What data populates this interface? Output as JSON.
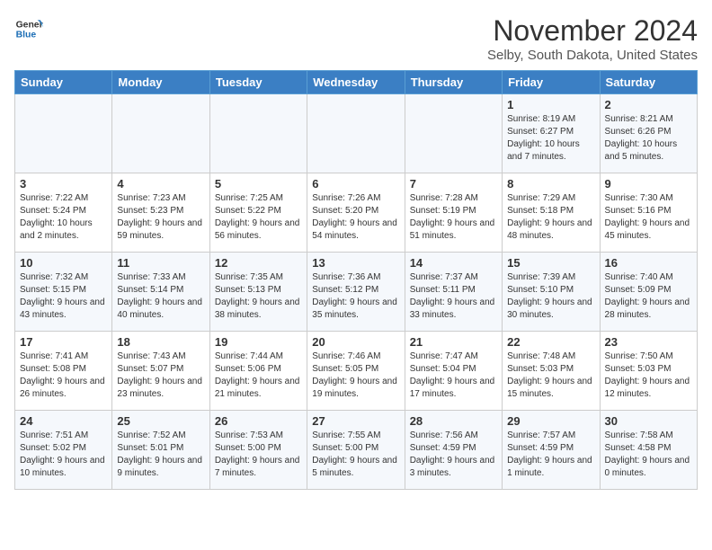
{
  "header": {
    "logo_line1": "General",
    "logo_line2": "Blue",
    "month": "November 2024",
    "location": "Selby, South Dakota, United States"
  },
  "days_of_week": [
    "Sunday",
    "Monday",
    "Tuesday",
    "Wednesday",
    "Thursday",
    "Friday",
    "Saturday"
  ],
  "weeks": [
    [
      {
        "num": "",
        "info": ""
      },
      {
        "num": "",
        "info": ""
      },
      {
        "num": "",
        "info": ""
      },
      {
        "num": "",
        "info": ""
      },
      {
        "num": "",
        "info": ""
      },
      {
        "num": "1",
        "info": "Sunrise: 8:19 AM\nSunset: 6:27 PM\nDaylight: 10 hours and 7 minutes."
      },
      {
        "num": "2",
        "info": "Sunrise: 8:21 AM\nSunset: 6:26 PM\nDaylight: 10 hours and 5 minutes."
      }
    ],
    [
      {
        "num": "3",
        "info": "Sunrise: 7:22 AM\nSunset: 5:24 PM\nDaylight: 10 hours and 2 minutes."
      },
      {
        "num": "4",
        "info": "Sunrise: 7:23 AM\nSunset: 5:23 PM\nDaylight: 9 hours and 59 minutes."
      },
      {
        "num": "5",
        "info": "Sunrise: 7:25 AM\nSunset: 5:22 PM\nDaylight: 9 hours and 56 minutes."
      },
      {
        "num": "6",
        "info": "Sunrise: 7:26 AM\nSunset: 5:20 PM\nDaylight: 9 hours and 54 minutes."
      },
      {
        "num": "7",
        "info": "Sunrise: 7:28 AM\nSunset: 5:19 PM\nDaylight: 9 hours and 51 minutes."
      },
      {
        "num": "8",
        "info": "Sunrise: 7:29 AM\nSunset: 5:18 PM\nDaylight: 9 hours and 48 minutes."
      },
      {
        "num": "9",
        "info": "Sunrise: 7:30 AM\nSunset: 5:16 PM\nDaylight: 9 hours and 45 minutes."
      }
    ],
    [
      {
        "num": "10",
        "info": "Sunrise: 7:32 AM\nSunset: 5:15 PM\nDaylight: 9 hours and 43 minutes."
      },
      {
        "num": "11",
        "info": "Sunrise: 7:33 AM\nSunset: 5:14 PM\nDaylight: 9 hours and 40 minutes."
      },
      {
        "num": "12",
        "info": "Sunrise: 7:35 AM\nSunset: 5:13 PM\nDaylight: 9 hours and 38 minutes."
      },
      {
        "num": "13",
        "info": "Sunrise: 7:36 AM\nSunset: 5:12 PM\nDaylight: 9 hours and 35 minutes."
      },
      {
        "num": "14",
        "info": "Sunrise: 7:37 AM\nSunset: 5:11 PM\nDaylight: 9 hours and 33 minutes."
      },
      {
        "num": "15",
        "info": "Sunrise: 7:39 AM\nSunset: 5:10 PM\nDaylight: 9 hours and 30 minutes."
      },
      {
        "num": "16",
        "info": "Sunrise: 7:40 AM\nSunset: 5:09 PM\nDaylight: 9 hours and 28 minutes."
      }
    ],
    [
      {
        "num": "17",
        "info": "Sunrise: 7:41 AM\nSunset: 5:08 PM\nDaylight: 9 hours and 26 minutes."
      },
      {
        "num": "18",
        "info": "Sunrise: 7:43 AM\nSunset: 5:07 PM\nDaylight: 9 hours and 23 minutes."
      },
      {
        "num": "19",
        "info": "Sunrise: 7:44 AM\nSunset: 5:06 PM\nDaylight: 9 hours and 21 minutes."
      },
      {
        "num": "20",
        "info": "Sunrise: 7:46 AM\nSunset: 5:05 PM\nDaylight: 9 hours and 19 minutes."
      },
      {
        "num": "21",
        "info": "Sunrise: 7:47 AM\nSunset: 5:04 PM\nDaylight: 9 hours and 17 minutes."
      },
      {
        "num": "22",
        "info": "Sunrise: 7:48 AM\nSunset: 5:03 PM\nDaylight: 9 hours and 15 minutes."
      },
      {
        "num": "23",
        "info": "Sunrise: 7:50 AM\nSunset: 5:03 PM\nDaylight: 9 hours and 12 minutes."
      }
    ],
    [
      {
        "num": "24",
        "info": "Sunrise: 7:51 AM\nSunset: 5:02 PM\nDaylight: 9 hours and 10 minutes."
      },
      {
        "num": "25",
        "info": "Sunrise: 7:52 AM\nSunset: 5:01 PM\nDaylight: 9 hours and 9 minutes."
      },
      {
        "num": "26",
        "info": "Sunrise: 7:53 AM\nSunset: 5:00 PM\nDaylight: 9 hours and 7 minutes."
      },
      {
        "num": "27",
        "info": "Sunrise: 7:55 AM\nSunset: 5:00 PM\nDaylight: 9 hours and 5 minutes."
      },
      {
        "num": "28",
        "info": "Sunrise: 7:56 AM\nSunset: 4:59 PM\nDaylight: 9 hours and 3 minutes."
      },
      {
        "num": "29",
        "info": "Sunrise: 7:57 AM\nSunset: 4:59 PM\nDaylight: 9 hours and 1 minute."
      },
      {
        "num": "30",
        "info": "Sunrise: 7:58 AM\nSunset: 4:58 PM\nDaylight: 9 hours and 0 minutes."
      }
    ]
  ]
}
